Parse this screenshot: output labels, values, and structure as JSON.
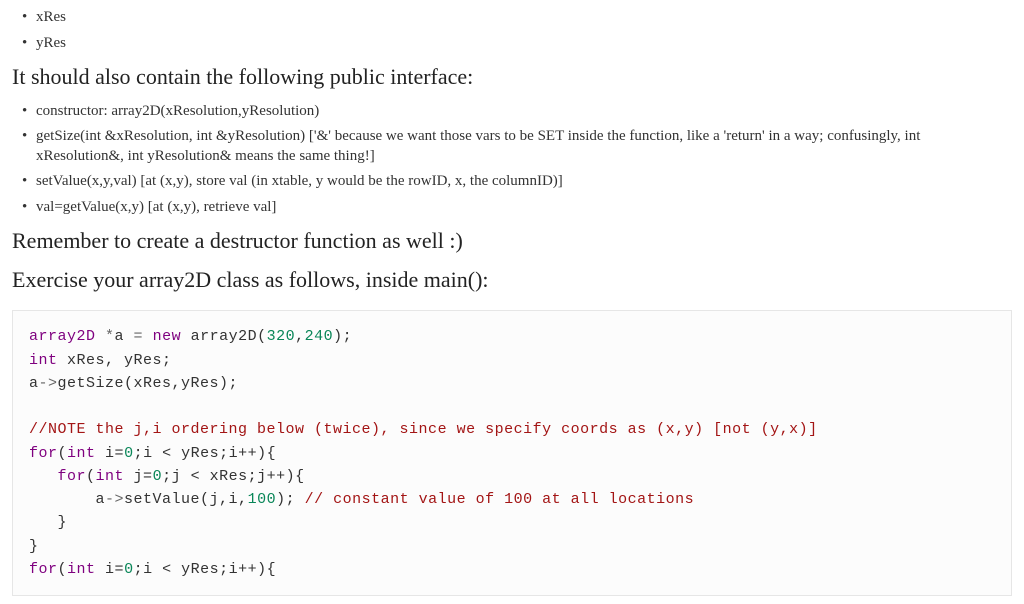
{
  "top_list": [
    "xRes",
    "yRes"
  ],
  "heading1": "It should also contain the following public interface:",
  "interface_list": [
    "constructor: array2D(xResolution,yResolution)",
    "getSize(int &xResolution, int &yResolution) ['&' because we want those vars to be SET inside the function, like a 'return' in a way; confusingly, int xResolution&, int yResolution& means the same thing!]",
    "setValue(x,y,val) [at (x,y), store val (in xtable, y would be the rowID, x, the columnID)]",
    "val=getValue(x,y) [at (x,y), retrieve val]"
  ],
  "heading2": "Remember to create a destructor function as well :)",
  "heading3": "Exercise your array2D class as follows, inside main():",
  "code": {
    "l1_a": "array2D ",
    "l1_b": "*",
    "l1_c": "a ",
    "l1_d": "= ",
    "l1_e": "new ",
    "l1_f": "array2D(",
    "l1_g": "320",
    "l1_h": ",",
    "l1_i": "240",
    "l1_j": ");",
    "l2_a": "int ",
    "l2_b": "xRes, yRes;",
    "l3_a": "a",
    "l3_b": "->",
    "l3_c": "getSize(xRes,yRes);",
    "l5": "//NOTE the j,i ordering below (twice), since we specify coords as (x,y) [not (y,x)]",
    "l6_a": "for",
    "l6_b": "(",
    "l6_c": "int ",
    "l6_d": "i=",
    "l6_e": "0",
    "l6_f": ";i < yRes;i++){",
    "l7_a": "   for",
    "l7_b": "(",
    "l7_c": "int ",
    "l7_d": "j=",
    "l7_e": "0",
    "l7_f": ";j < xRes;j++){",
    "l8_a": "       a",
    "l8_b": "->",
    "l8_c": "setValue(j,i,",
    "l8_d": "100",
    "l8_e": "); ",
    "l8_f": "// constant value of 100 at all locations",
    "l9": "   }",
    "l10": "}",
    "l11_a": "for",
    "l11_b": "(",
    "l11_c": "int ",
    "l11_d": "i=",
    "l11_e": "0",
    "l11_f": ";i < yRes;i++){"
  }
}
